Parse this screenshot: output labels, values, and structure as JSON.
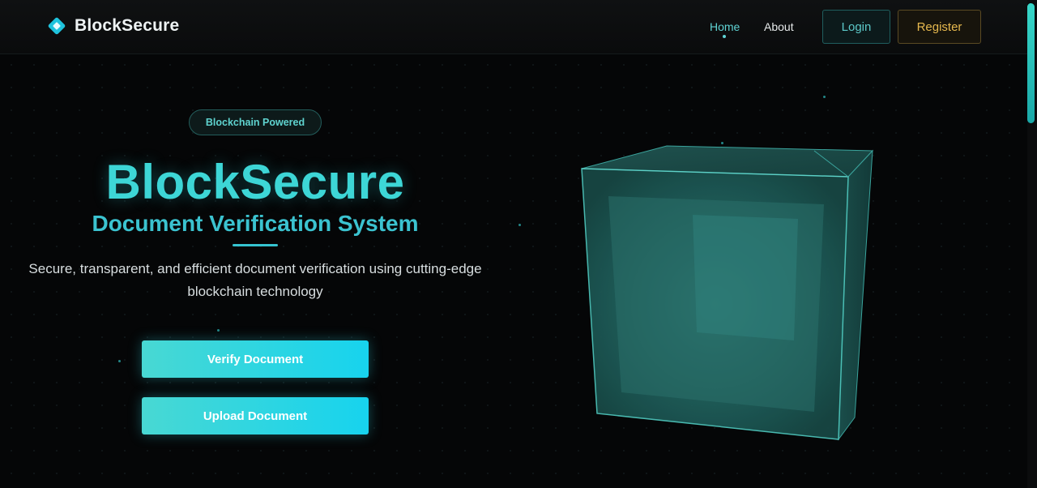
{
  "header": {
    "brand": "BlockSecure",
    "nav": {
      "home": "Home",
      "about": "About"
    },
    "login_label": "Login",
    "register_label": "Register"
  },
  "hero": {
    "badge": "Blockchain Powered",
    "title": "BlockSecure",
    "subtitle": "Document Verification System",
    "description": "Secure, transparent, and efficient document verification using cutting-edge blockchain technology",
    "verify_label": "Verify Document",
    "upload_label": "Upload Document"
  },
  "colors": {
    "accent": "#3dd6d6",
    "register": "#e6b84e",
    "background": "#050607"
  },
  "icons": {
    "logo": "diamond-logo-icon",
    "hero_visual": "glass-cube-illustration"
  }
}
